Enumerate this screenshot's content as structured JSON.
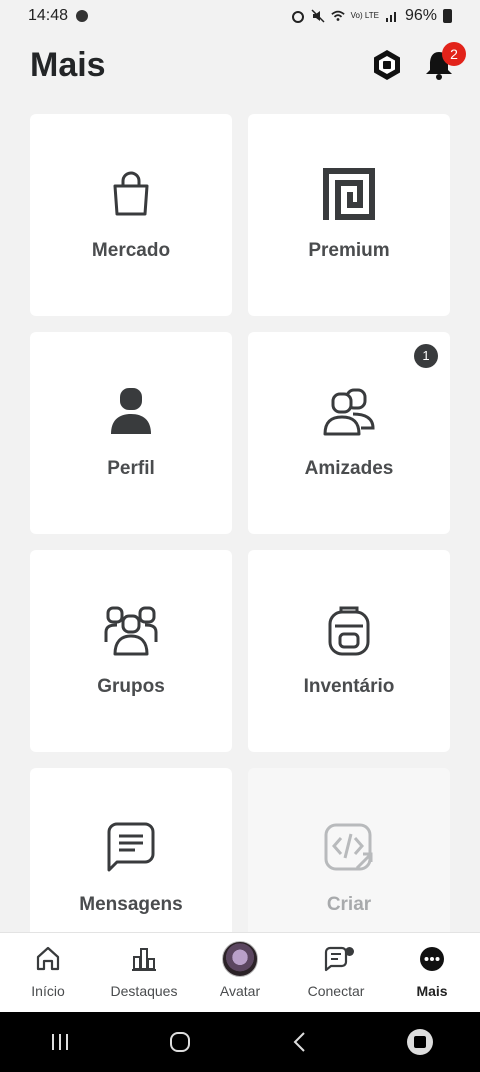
{
  "status_bar": {
    "time": "14:48",
    "battery": "96%",
    "network": "Vo) LTE"
  },
  "header": {
    "title": "Mais",
    "notification_count": "2",
    "robux_icon": "robux-icon",
    "bell_icon": "bell-icon"
  },
  "tiles": [
    {
      "label": "Mercado",
      "icon": "shopping-bag-icon",
      "badge": ""
    },
    {
      "label": "Premium",
      "icon": "premium-icon",
      "badge": ""
    },
    {
      "label": "Perfil",
      "icon": "person-icon",
      "badge": ""
    },
    {
      "label": "Amizades",
      "icon": "friends-icon",
      "badge": "1"
    },
    {
      "label": "Grupos",
      "icon": "groups-icon",
      "badge": ""
    },
    {
      "label": "Inventário",
      "icon": "backpack-icon",
      "badge": ""
    },
    {
      "label": "Mensagens",
      "icon": "message-icon",
      "badge": ""
    },
    {
      "label": "Criar",
      "icon": "create-code-icon",
      "badge": ""
    }
  ],
  "bottom_nav": [
    {
      "label": "Início",
      "icon": "home-icon"
    },
    {
      "label": "Destaques",
      "icon": "charts-icon"
    },
    {
      "label": "Avatar",
      "icon": "avatar"
    },
    {
      "label": "Conectar",
      "icon": "chat-icon"
    },
    {
      "label": "Mais",
      "icon": "more-icon"
    }
  ],
  "colors": {
    "badge_red": "#e2231a",
    "text": "#393b3d",
    "background": "#f2f2f2"
  }
}
